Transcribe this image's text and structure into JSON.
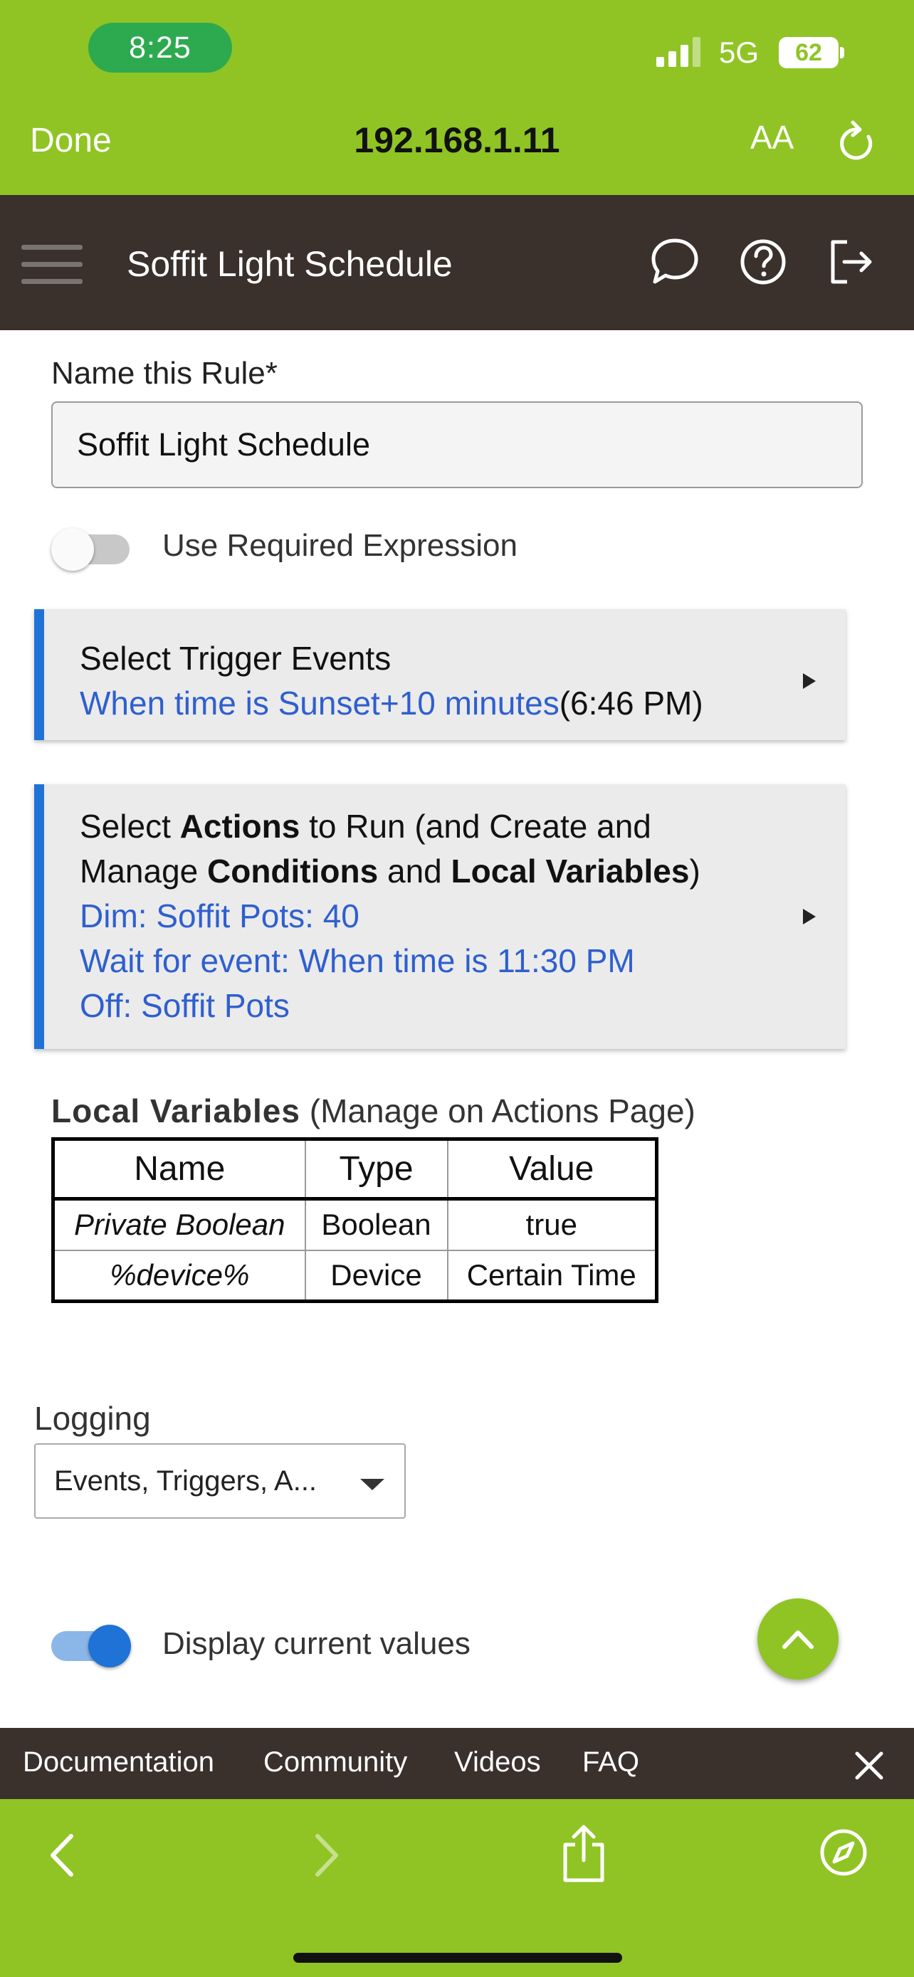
{
  "status_bar": {
    "time": "8:25",
    "network": "5G",
    "battery": "62"
  },
  "browser": {
    "done_label": "Done",
    "url": "192.168.1.11",
    "text_size_label": "AA"
  },
  "header": {
    "title": "Soffit Light Schedule"
  },
  "rule_name": {
    "label": "Name this Rule*",
    "value": "Soffit Light Schedule"
  },
  "required_expression": {
    "label": "Use Required Expression",
    "enabled": false
  },
  "trigger_card": {
    "title": "Select Trigger Events",
    "detail_link": "When time is Sunset+10 minutes",
    "detail_suffix": "(6:46 PM)"
  },
  "actions_card": {
    "l1_a": "Select ",
    "l1_b": "Actions",
    "l1_c": " to Run (and Create and",
    "l2_a": "Manage ",
    "l2_b": "Conditions",
    "l2_c": " and ",
    "l2_d": "Local Variables",
    "l2_e": ")",
    "actions": [
      "Dim: Soffit Pots: 40",
      "Wait for event: When time is 11:30 PM",
      "Off: Soffit Pots"
    ]
  },
  "local_variables": {
    "heading": "Local Variables",
    "note": "(Manage on Actions Page)",
    "columns": [
      "Name",
      "Type",
      "Value"
    ],
    "rows": [
      [
        "Private Boolean",
        "Boolean",
        "true"
      ],
      [
        "%device%",
        "Device",
        "Certain Time"
      ]
    ]
  },
  "logging": {
    "label": "Logging",
    "selected": "Events, Triggers, A..."
  },
  "display_values": {
    "label": "Display current values",
    "enabled": true
  },
  "footer": {
    "links": [
      "Documentation",
      "Community",
      "Videos",
      "FAQ"
    ]
  },
  "colors": {
    "brand_green": "#8fc424",
    "header_dark": "#3a302c",
    "accent_blue": "#1f73d6",
    "link_blue": "#2f5fcf"
  }
}
